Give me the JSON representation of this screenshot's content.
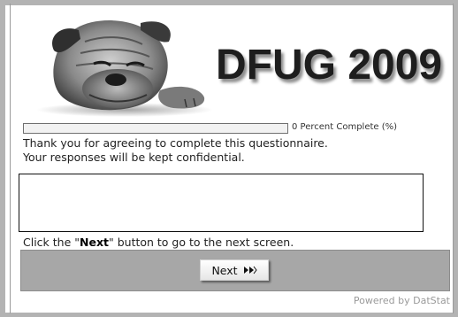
{
  "banner": {
    "title": "DFUG 2009",
    "image": "shar-pei-dog-photo"
  },
  "progress": {
    "percent": 0,
    "label": "0 Percent Complete (%)"
  },
  "intro": {
    "line1": "Thank you for agreeing to complete this questionnaire.",
    "line2": "Your responses will be kept confidential."
  },
  "textbox": {
    "value": ""
  },
  "instructions": {
    "prefix": "Click the \"",
    "bold": "Next",
    "suffix": "\" button to go to the next screen."
  },
  "nav": {
    "next_label": "Next",
    "next_icon": "double-chevron-right-icon"
  },
  "footer": {
    "powered_by": "Powered by DatStat"
  },
  "colors": {
    "nav_bar": "#a7a7a7",
    "frame": "#b3b3b3",
    "title": "#1e1e1e"
  }
}
